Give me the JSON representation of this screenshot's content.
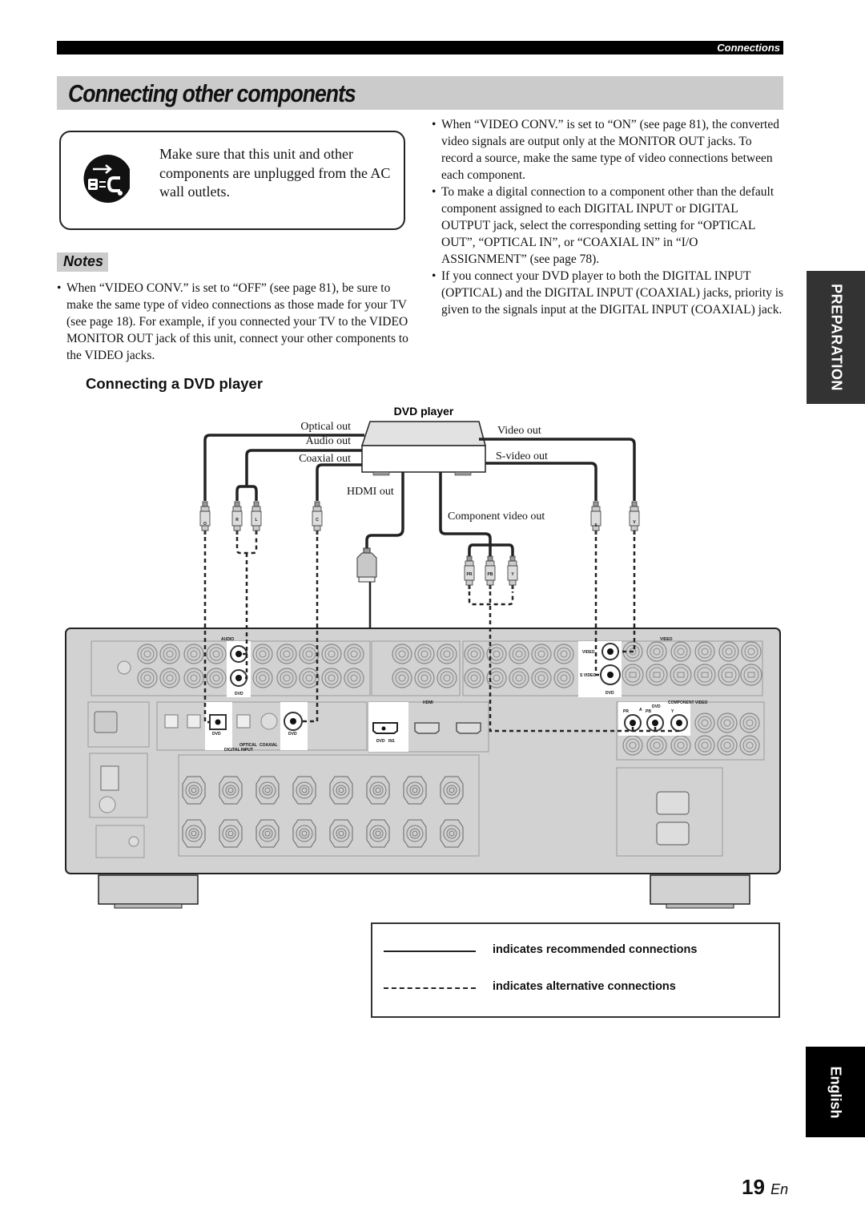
{
  "header": {
    "section_label": "Connections",
    "page_title": "Connecting other components"
  },
  "warning": {
    "icon": "unplug-icon",
    "text": "Make sure that this unit and other components are unplugged from the AC wall outlets."
  },
  "notes": {
    "heading": "Notes",
    "left": [
      "When “VIDEO CONV.” is set to “OFF” (see page 81), be sure to make the same type of video connections as those made for your TV (see page 18). For example, if you connected your TV to the VIDEO MONITOR OUT jack of this unit, connect your other components to the VIDEO jacks."
    ],
    "right": [
      "When “VIDEO CONV.” is set to “ON” (see page 81), the converted video signals are output only at the MONITOR OUT jacks. To record a source, make the same type of video connections between each component.",
      "To make a digital connection to a component other than the default component assigned to each DIGITAL INPUT or DIGITAL OUTPUT jack, select the corresponding setting for “OPTICAL OUT”, “OPTICAL IN”, or “COAXIAL IN” in “I/O ASSIGNMENT” (see page 78).",
      "If you connect your DVD player to both the DIGITAL INPUT (OPTICAL) and the DIGITAL INPUT (COAXIAL) jacks, priority is given to the signals input at the DIGITAL INPUT (COAXIAL) jack."
    ]
  },
  "side_tabs": {
    "section": "PREPARATION",
    "language": "English"
  },
  "subsection_title": "Connecting a DVD player",
  "diagram": {
    "device_title": "DVD player",
    "outputs": {
      "optical": "Optical out",
      "audio": "Audio out",
      "coaxial": "Coaxial out",
      "hdmi": "HDMI out",
      "video": "Video out",
      "svideo": "S-video out",
      "component": "Component video out"
    },
    "plugs": {
      "O": "O",
      "R": "R",
      "L": "L",
      "C": "C",
      "S": "S",
      "V": "V",
      "PR": "PR",
      "PB": "PB",
      "Y": "Y"
    },
    "panel_labels": {
      "audio": "AUDIO",
      "dvd": "DVD",
      "digital_input": "DIGITAL INPUT",
      "optical": "OPTICAL",
      "coaxial": "COAXIAL",
      "hdmi": "HDMI",
      "hdmi_in": "IN1",
      "video": "VIDEO",
      "s_video": "S VIDEO",
      "component_video": "COMPONENT VIDEO",
      "a": "A"
    }
  },
  "legend": {
    "recommended": "indicates recommended connections",
    "alternative": "indicates alternative connections"
  },
  "footer": {
    "page_number": "19",
    "lang_code": "En"
  }
}
